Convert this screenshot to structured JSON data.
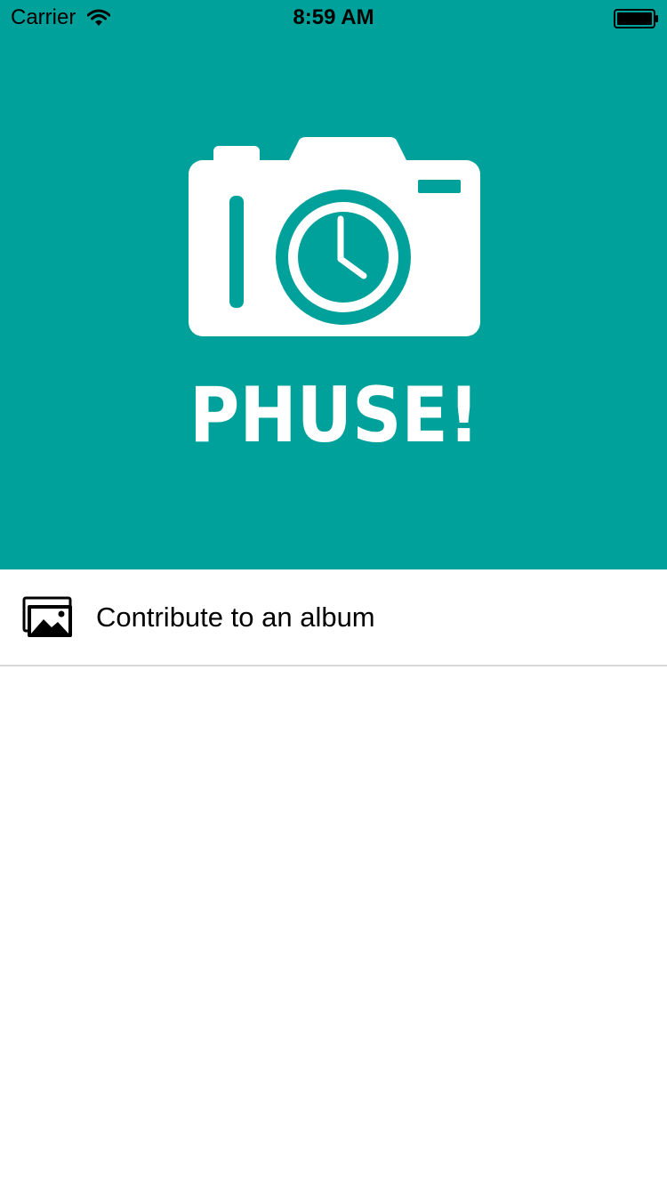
{
  "status_bar": {
    "carrier": "Carrier",
    "time": "8:59 AM",
    "wifi_icon": "wifi-icon",
    "battery_icon": "battery-icon"
  },
  "header": {
    "background_color": "#00a19a",
    "logo_icon": "camera-clock-icon",
    "logo_text": "PHUSE!"
  },
  "menu": {
    "items": [
      {
        "label": "Contribute to an album",
        "icon": "photo-album-icon"
      }
    ]
  }
}
